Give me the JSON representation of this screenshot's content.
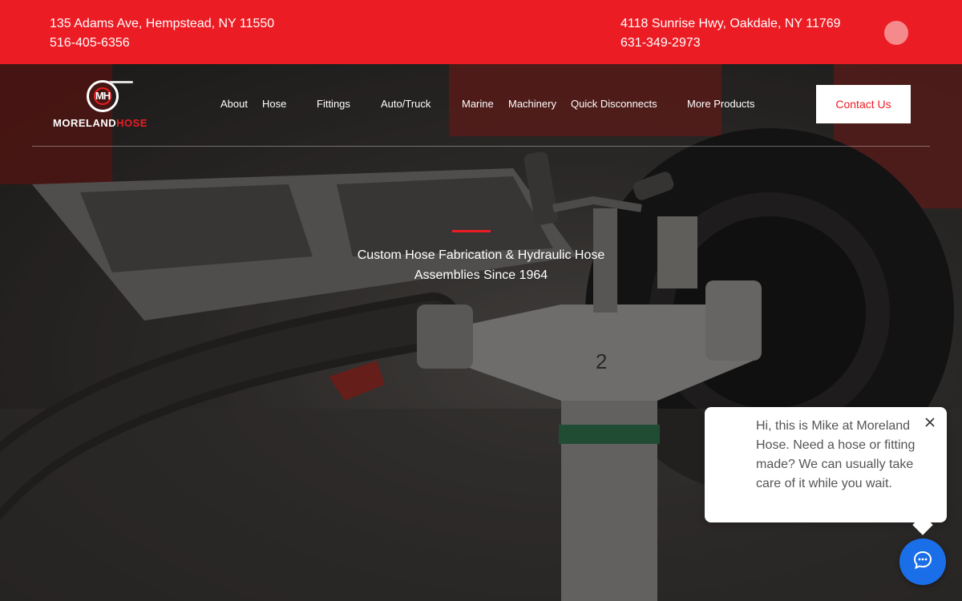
{
  "topbar": {
    "location_left": {
      "address": "135 Adams Ave, Hempstead, NY 11550",
      "phone": "516-405-6356"
    },
    "location_right": {
      "address": "4118 Sunrise Hwy, Oakdale, NY 11769",
      "phone": "631-349-2973"
    }
  },
  "logo": {
    "mark": "MH",
    "name_part1": "MORELAND",
    "name_part2": "HOSE"
  },
  "nav": {
    "items": [
      "About",
      "Hose",
      "Fittings",
      "Auto/Truck",
      "Marine",
      "Machinery",
      "Quick Disconnects",
      "More Products"
    ],
    "contact_label": "Contact Us"
  },
  "hero": {
    "tagline_line1": "Custom Hose Fabrication & Hydraulic Hose",
    "tagline_line2": "Assemblies Since 1964"
  },
  "chat": {
    "message": "Hi, this is Mike at Moreland Hose. Need a hose or fitting made? We can usually take care of it while you wait.",
    "close_icon": "close-icon",
    "launcher_icon": "chat-icon"
  },
  "colors": {
    "brand_red": "#ec1c24",
    "chat_blue": "#1a6fe8"
  }
}
